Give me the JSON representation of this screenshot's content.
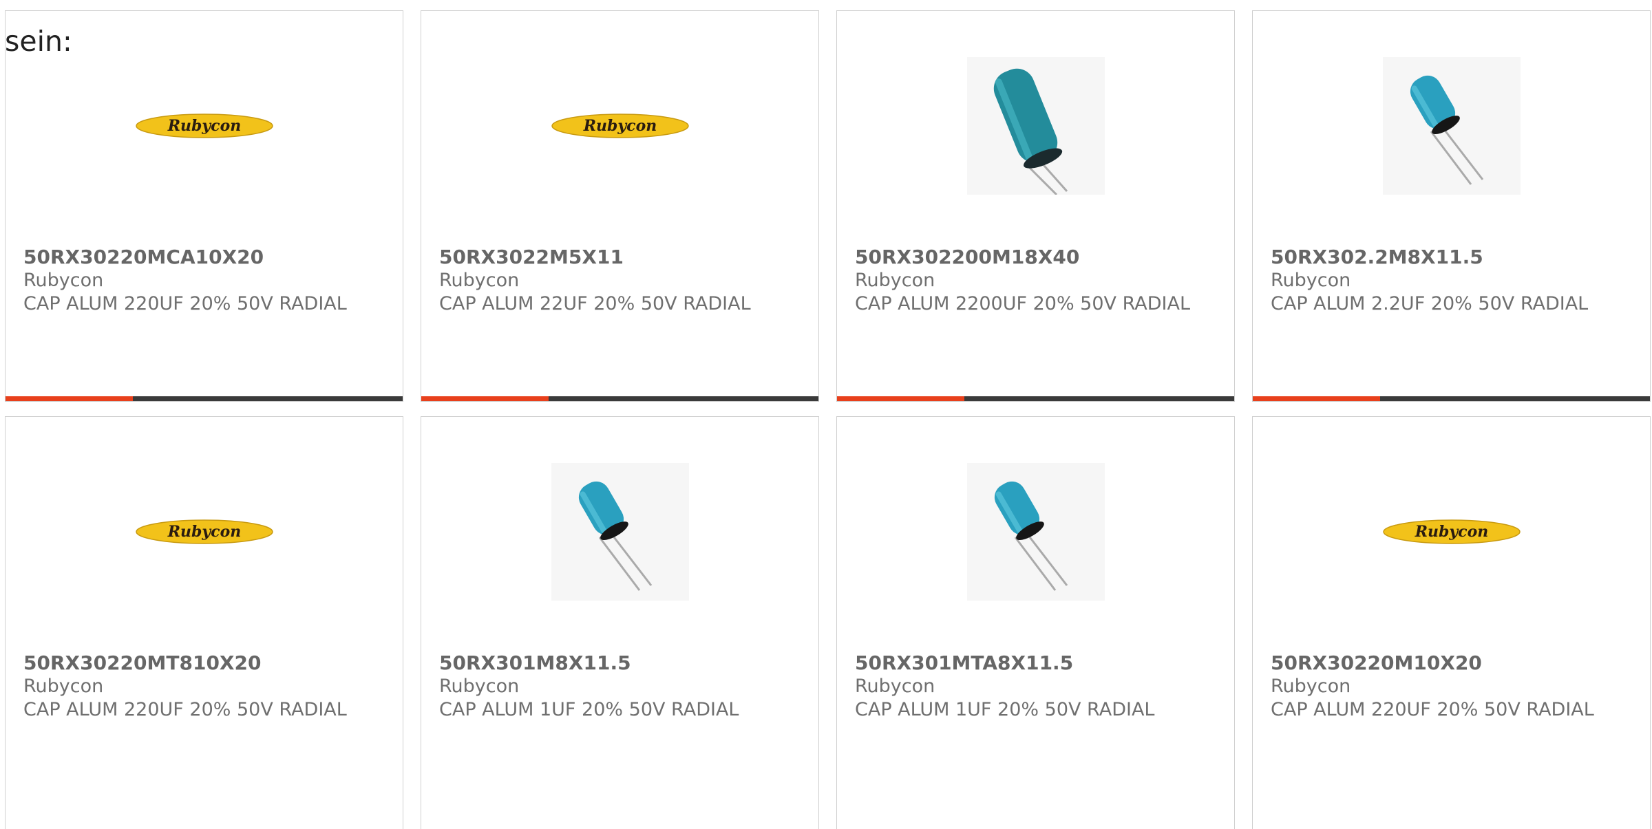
{
  "intro_text": "sein:",
  "accent_color": "#e8401c",
  "progress_bar": {
    "fill_fraction": 0.32
  },
  "products": [
    {
      "part_number": "50RX30220MCA10X20",
      "manufacturer": "Rubycon",
      "description": "CAP ALUM 220UF 20% 50V RADIAL",
      "image": "rubycon-logo",
      "logo_text": "Rubycon"
    },
    {
      "part_number": "50RX3022M5X11",
      "manufacturer": "Rubycon",
      "description": "CAP ALUM 22UF 20% 50V RADIAL",
      "image": "rubycon-logo",
      "logo_text": "Rubycon"
    },
    {
      "part_number": "50RX302200M18X40",
      "manufacturer": "Rubycon",
      "description": "CAP ALUM 2200UF 20% 50V RADIAL",
      "image": "capacitor-large-photo"
    },
    {
      "part_number": "50RX302.2M8X11.5",
      "manufacturer": "Rubycon",
      "description": "CAP ALUM 2.2UF 20% 50V RADIAL",
      "image": "capacitor-small-photo"
    },
    {
      "part_number": "50RX30220MT810X20",
      "manufacturer": "Rubycon",
      "description": "CAP ALUM 220UF 20% 50V RADIAL",
      "image": "rubycon-logo",
      "logo_text": "Rubycon"
    },
    {
      "part_number": "50RX301M8X11.5",
      "manufacturer": "Rubycon",
      "description": "CAP ALUM 1UF 20% 50V RADIAL",
      "image": "capacitor-small-photo"
    },
    {
      "part_number": "50RX301MTA8X11.5",
      "manufacturer": "Rubycon",
      "description": "CAP ALUM 1UF 20% 50V RADIAL",
      "image": "capacitor-small-photo"
    },
    {
      "part_number": "50RX30220M10X20",
      "manufacturer": "Rubycon",
      "description": "CAP ALUM 220UF 20% 50V RADIAL",
      "image": "rubycon-logo",
      "logo_text": "Rubycon"
    }
  ]
}
